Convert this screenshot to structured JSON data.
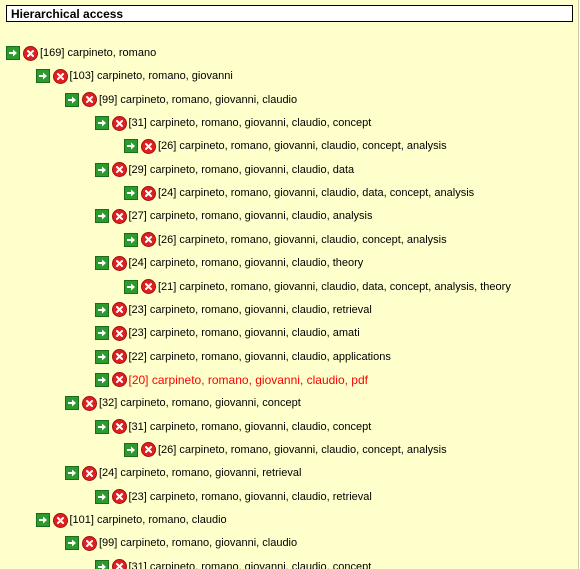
{
  "header": {
    "title": "Hierarchical access"
  },
  "tree": [
    {
      "text": "[169] carpineto, romano",
      "depth": 0
    },
    {
      "text": "[103] carpineto, romano, giovanni",
      "depth": 1
    },
    {
      "text": "[99] carpineto, romano, giovanni, claudio",
      "depth": 2
    },
    {
      "text": "[31] carpineto, romano, giovanni, claudio, concept",
      "depth": 3
    },
    {
      "text": "[26] carpineto, romano, giovanni, claudio, concept, analysis",
      "depth": 4
    },
    {
      "text": "[29] carpineto, romano, giovanni, claudio, data",
      "depth": 3
    },
    {
      "text": "[24] carpineto, romano, giovanni, claudio, data, concept, analysis",
      "depth": 4
    },
    {
      "text": "[27] carpineto, romano, giovanni, claudio, analysis",
      "depth": 3
    },
    {
      "text": "[26] carpineto, romano, giovanni, claudio, concept, analysis",
      "depth": 4
    },
    {
      "text": "[24] carpineto, romano, giovanni, claudio, theory",
      "depth": 3
    },
    {
      "text": "[21] carpineto, romano, giovanni, claudio, data, concept, analysis, theory",
      "depth": 4
    },
    {
      "text": "[23] carpineto, romano, giovanni, claudio, retrieval",
      "depth": 3
    },
    {
      "text": "[23] carpineto, romano, giovanni, claudio, amati",
      "depth": 3
    },
    {
      "text": "[22] carpineto, romano, giovanni, claudio, applications",
      "depth": 3
    },
    {
      "text": "[20] carpineto, romano, giovanni, claudio, pdf",
      "depth": 3,
      "selected": true
    },
    {
      "text": "[32] carpineto, romano, giovanni, concept",
      "depth": 2
    },
    {
      "text": "[31] carpineto, romano, giovanni, claudio, concept",
      "depth": 3
    },
    {
      "text": "[26] carpineto, romano, giovanni, claudio, concept, analysis",
      "depth": 4
    },
    {
      "text": "[24] carpineto, romano, giovanni, retrieval",
      "depth": 2
    },
    {
      "text": "[23] carpineto, romano, giovanni, claudio, retrieval",
      "depth": 3
    },
    {
      "text": "[101] carpineto, romano, claudio",
      "depth": 1
    },
    {
      "text": "[99] carpineto, romano, giovanni, claudio",
      "depth": 2
    },
    {
      "text": "[31] carpineto, romano, giovanni, claudio, concept",
      "depth": 3
    }
  ],
  "icons": {
    "go": "arrow-right-icon",
    "remove": "remove-x-icon"
  },
  "colors": {
    "panel_background": "#ffffcc",
    "go_icon": "#2d9a2d",
    "remove_icon": "#e02020",
    "selected_text": "#ff0000"
  }
}
